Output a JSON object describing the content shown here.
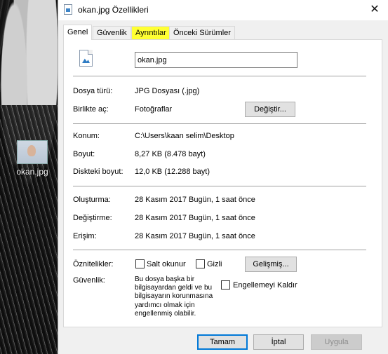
{
  "desktop": {
    "icon_name": "okan.jpg"
  },
  "window": {
    "title": "okan.jpg Özellikleri",
    "close_glyph": "✕"
  },
  "tabs": [
    {
      "label": "Genel",
      "active": true
    },
    {
      "label": "Güvenlik"
    },
    {
      "label": "Ayrıntılar",
      "highlighted": true
    },
    {
      "label": "Önceki Sürümler"
    }
  ],
  "general": {
    "file_name": "okan.jpg",
    "file_type_label": "Dosya türü:",
    "file_type_value": "JPG Dosyası (.jpg)",
    "opens_with_label": "Birlikte aç:",
    "opens_with_value": "Fotoğraflar",
    "change_button": "Değiştir...",
    "location_label": "Konum:",
    "location_value": "C:\\Users\\kaan selim\\Desktop",
    "size_label": "Boyut:",
    "size_value": "8,27 KB (8.478 bayt)",
    "size_on_disk_label": "Diskteki boyut:",
    "size_on_disk_value": "12,0 KB (12.288 bayt)",
    "created_label": "Oluşturma:",
    "created_value": "28 Kasım 2017 Bugün, 1 saat önce",
    "modified_label": "Değiştirme:",
    "modified_value": "28 Kasım 2017 Bugün, 1 saat önce",
    "accessed_label": "Erişim:",
    "accessed_value": "28 Kasım 2017 Bugün, 1 saat önce",
    "attributes_label": "Öznitelikler:",
    "readonly_label": "Salt okunur",
    "hidden_label": "Gizli",
    "advanced_button": "Gelişmiş...",
    "security_label": "Güvenlik:",
    "security_text": "Bu dosya başka bir bilgisayardan geldi ve bu bilgisayarın korunmasına yardımcı olmak için engellenmiş olabilir.",
    "unblock_label": "Engellemeyi Kaldır"
  },
  "footer": {
    "ok_button": "Tamam",
    "cancel_button": "İptal",
    "apply_button": "Uygula"
  },
  "colors": {
    "highlight": "#ffff33",
    "accent": "#0078d7"
  }
}
